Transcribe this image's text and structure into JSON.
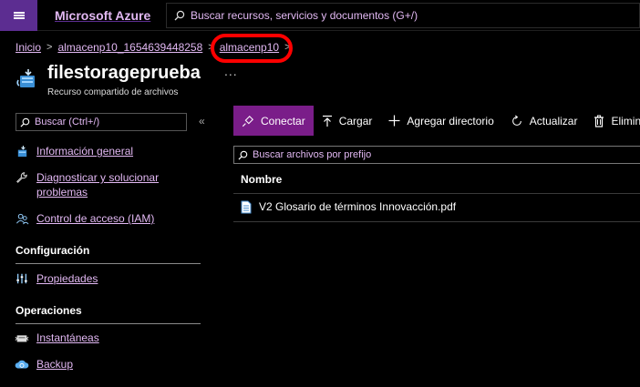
{
  "topbar": {
    "brand": "Microsoft Azure",
    "search_placeholder": "Buscar recursos, servicios y documentos (G+/)"
  },
  "breadcrumb": {
    "items": [
      "Inicio",
      "almacenp10_1654639448258",
      "almacenp10"
    ]
  },
  "resource": {
    "title": "filestorageprueba",
    "subtitle": "Recurso compartido de archivos",
    "more": "..."
  },
  "sidebar": {
    "search_placeholder": "Buscar (Ctrl+/)",
    "collapse": "«",
    "items": [
      {
        "label": "Información general",
        "icon": "file-share-icon"
      },
      {
        "label": "Diagnosticar y solucionar",
        "label2": "problemas",
        "icon": "wrench-icon"
      },
      {
        "label": "Control de acceso (IAM)",
        "icon": "people-icon"
      }
    ],
    "sections": [
      {
        "title": "Configuración",
        "items": [
          {
            "label": "Propiedades",
            "icon": "properties-icon"
          }
        ]
      },
      {
        "title": "Operaciones",
        "items": [
          {
            "label": "Instantáneas",
            "icon": "snapshot-icon"
          },
          {
            "label": "Backup",
            "icon": "cloud-backup-icon"
          }
        ]
      }
    ]
  },
  "toolbar": {
    "connect": "Conectar",
    "upload": "Cargar",
    "add_directory": "Agregar directorio",
    "refresh": "Actualizar",
    "delete": "Eliminar r"
  },
  "files": {
    "search_placeholder": "Buscar archivos por prefijo",
    "column_name": "Nombre",
    "rows": [
      {
        "name": "V2 Glosario de términos Innovacción.pdf",
        "icon": "document-icon"
      }
    ]
  },
  "colors": {
    "accent": "#5c2d91",
    "link": "#e2b8f3",
    "primary_button": "#7a1d89",
    "annotation": "#ff0000"
  }
}
